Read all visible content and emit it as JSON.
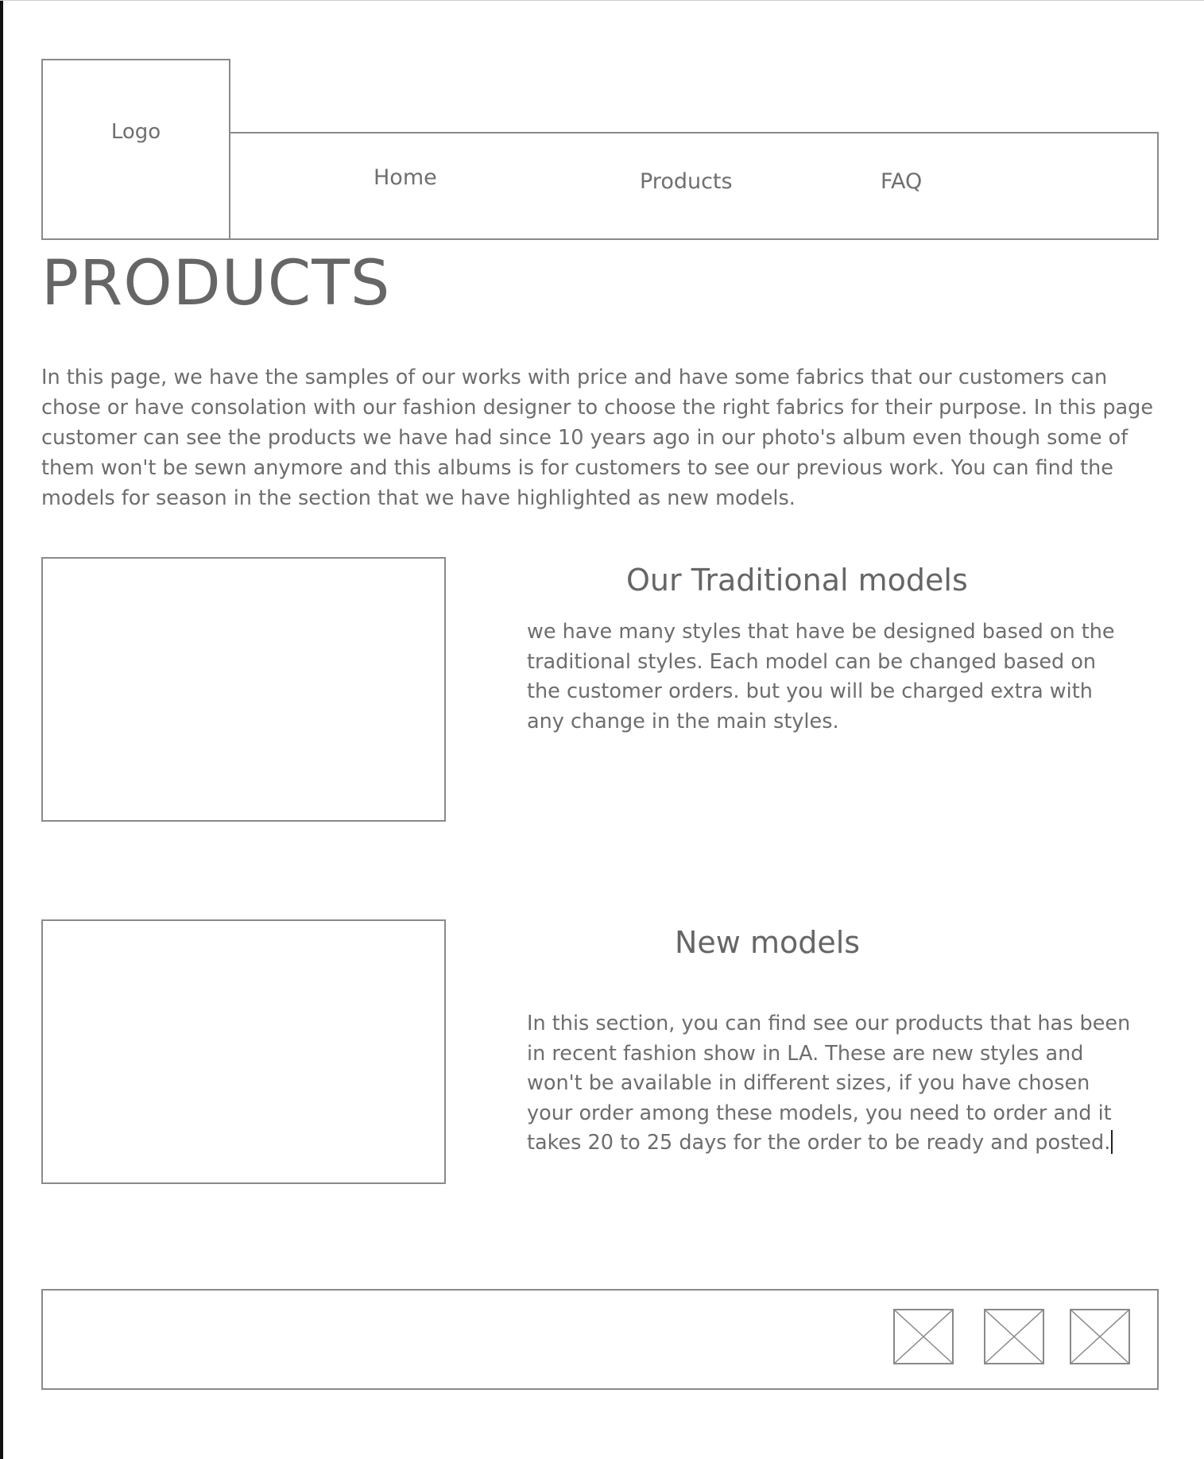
{
  "header": {
    "logo_label": "Logo",
    "nav": {
      "home": "Home",
      "products": "Products",
      "faq": "FAQ"
    }
  },
  "main": {
    "title": "PRODUCTS",
    "intro": "In this page, we have the samples of our works with price and have some fabrics that our customers can chose or have consolation with our fashion designer to choose the right fabrics for their purpose. In this page customer can see the products we have had since 10 years ago in our photo's album even though some of them won't be sewn anymore and this albums is for customers to see our previous work. You can find the models for season in the section that we have highlighted as new models.",
    "sections": [
      {
        "heading": "Our Traditional models",
        "text": "we have many styles that have be designed based on the traditional styles. Each model can be changed based on the customer orders. but you will be charged extra with any change in the main styles."
      },
      {
        "heading": "New models",
        "text": "In this section, you can find see our products that has been in recent fashion show in LA. These are new styles and won't be available in different sizes, if you have chosen your order among these models, you need to order and it takes 20 to 25 days for the order to be ready and posted."
      }
    ]
  },
  "footer": {
    "icons": [
      "image-placeholder-icon",
      "image-placeholder-icon",
      "image-placeholder-icon"
    ]
  },
  "colors": {
    "border": "#8a8a8a",
    "text": "#6d6d6d",
    "background": "#ffffff"
  }
}
